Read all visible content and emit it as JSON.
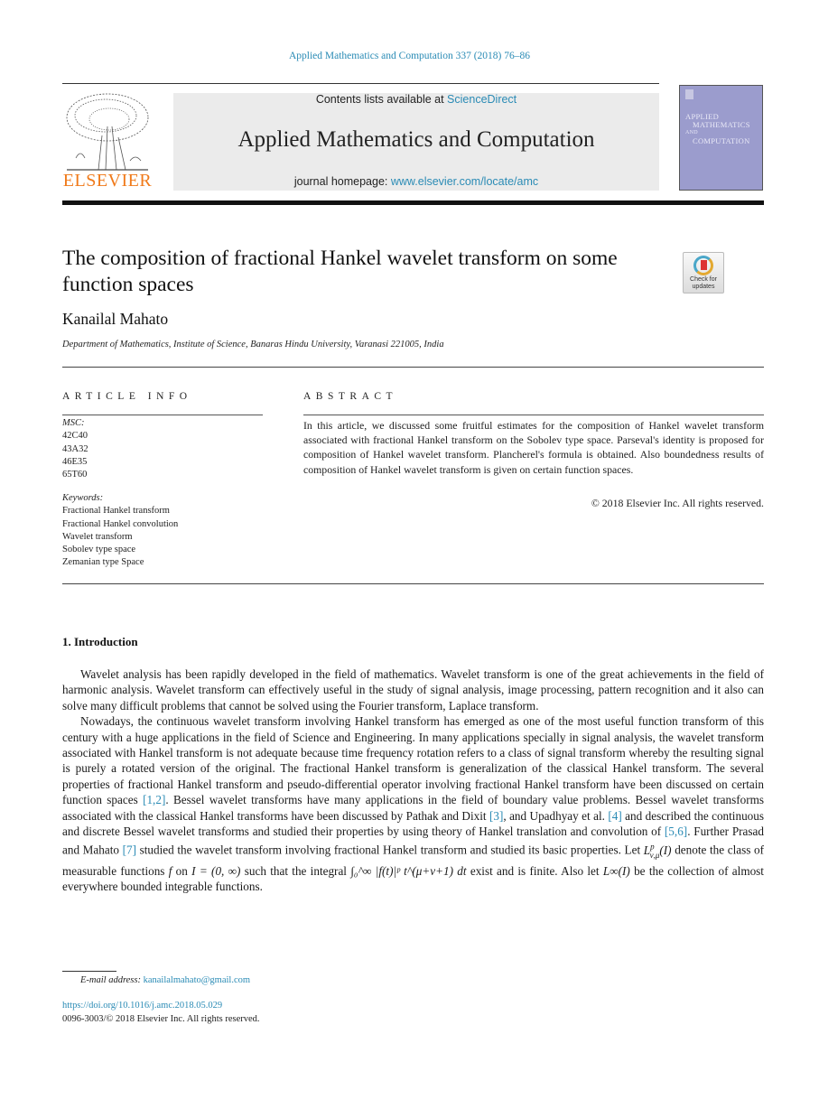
{
  "running_head": "Applied Mathematics and Computation 337 (2018) 76–86",
  "publisher": {
    "logo_word": "ELSEVIER",
    "brand_color": "#f07a1a"
  },
  "banner": {
    "contents_prefix": "Contents lists available at ",
    "contents_link": "ScienceDirect",
    "journal_title": "Applied Mathematics and Computation",
    "homepage_prefix": "journal homepage: ",
    "homepage_link": "www.elsevier.com/locate/amc"
  },
  "cover": {
    "line1": "APPLIED",
    "line2": "MATHEMATICS",
    "line3": "AND",
    "line4": "COMPUTATION"
  },
  "article": {
    "title": "The composition of fractional Hankel wavelet transform on some function spaces",
    "author": "Kanailal Mahato",
    "affiliation": "Department of Mathematics, Institute of Science, Banaras Hindu University, Varanasi 221005, India",
    "crossmark_label": "Check for updates"
  },
  "article_info": {
    "heading": "ARTICLE INFO",
    "msc_label": "MSC:",
    "msc_codes": [
      "42C40",
      "43A32",
      "46E35",
      "65T60"
    ],
    "keywords_label": "Keywords:",
    "keywords": [
      "Fractional Hankel transform",
      "Fractional Hankel convolution",
      "Wavelet transform",
      "Sobolev type space",
      "Zemanian type Space"
    ]
  },
  "abstract": {
    "heading": "ABSTRACT",
    "text": "In this article, we discussed some fruitful estimates for the composition of Hankel wavelet transform associated with fractional Hankel transform on the Sobolev type space. Parseval's identity is proposed for composition of Hankel wavelet transform. Plancherel's formula is obtained. Also boundedness results of composition of Hankel wavelet transform is given on certain function spaces.",
    "copyright": "© 2018 Elsevier Inc. All rights reserved."
  },
  "section1": {
    "heading": "1. Introduction",
    "para1": "Wavelet analysis has been rapidly developed in the field of mathematics. Wavelet transform is one of the great achievements in the field of harmonic analysis. Wavelet transform can effectively useful in the study of signal analysis, image processing, pattern recognition and it also can solve many difficult problems that cannot be solved using the Fourier transform, Laplace transform.",
    "para2_a": "Nowadays, the continuous wavelet transform involving Hankel transform has emerged as one of the most useful function transform of this century with a huge applications in the field of Science and Engineering. In many applications specially in signal analysis, the wavelet transform associated with Hankel transform is not adequate because time frequency rotation refers to a class of signal transform whereby the resulting signal is purely a rotated version of the original. The fractional Hankel transform is generalization of the classical Hankel transform. The several properties of fractional Hankel transform and pseudo-differential operator involving fractional Hankel transform have been discussed on certain function spaces ",
    "ref_1_2": "[1,2]",
    "para2_b": ". Bessel wavelet transforms have many applications in the field of boundary value problems. Bessel wavelet transforms associated with the classical Hankel transforms have been discussed by Pathak and Dixit ",
    "ref_3": "[3]",
    "para2_c": ", and Upadhyay et al. ",
    "ref_4": "[4]",
    "para2_d": " and described the continuous and discrete Bessel wavelet transforms and studied their properties by using theory of Hankel translation and convolution of ",
    "ref_5_6": "[5,6]",
    "para2_e": ". Further Prasad and Mahato ",
    "ref_7": "[7]",
    "para2_f": " studied the wavelet transform involving fractional Hankel transform and studied its basic properties. Let ",
    "math_L": "L",
    "math_L_sup": "p",
    "math_L_sub": "ν,μ",
    "math_L_arg": "(I)",
    "para2_g": " denote the class of measurable functions ",
    "math_f": "f",
    "para2_h": " on ",
    "math_interval": "I = (0, ∞)",
    "para2_i": " such that the integral ",
    "math_integral": "∫₀^∞ |f(t)|ᵖ t^(μ+ν+1) dt",
    "para2_j": " exist and is finite. Also let ",
    "math_Linf": "L∞(I)",
    "para2_k": " be the collection of almost everywhere bounded integrable functions."
  },
  "footer": {
    "email_label": "E-mail address: ",
    "email": "kanailalmahato@gmail.com",
    "doi": "https://doi.org/10.1016/j.amc.2018.05.029",
    "issn_copyright": "0096-3003/© 2018 Elsevier Inc. All rights reserved."
  }
}
